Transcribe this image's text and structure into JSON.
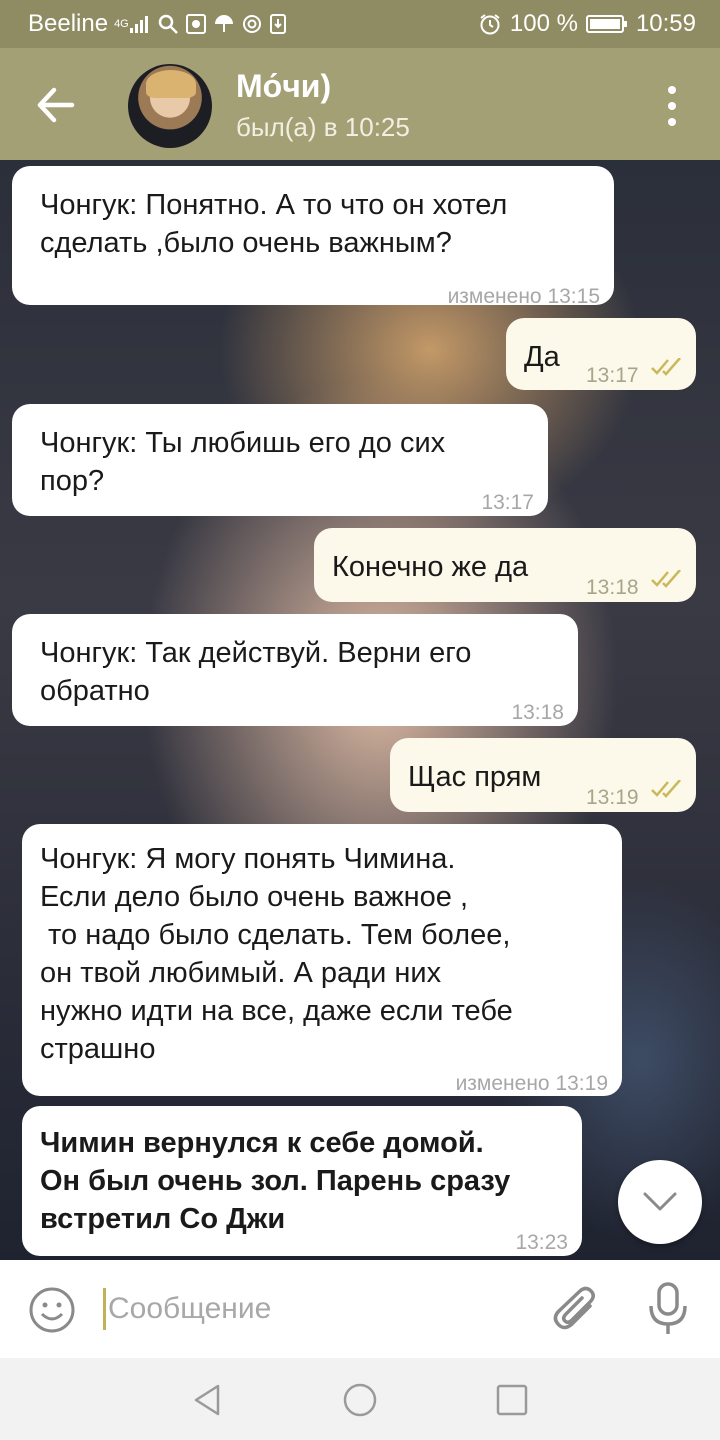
{
  "status_bar": {
    "carrier": "Beeline",
    "network": "4G",
    "battery": "100 %",
    "time": "10:59"
  },
  "header": {
    "title": "Мо́чи)",
    "subtitle": "был(а) в 10:25"
  },
  "messages": [
    {
      "direction": "in",
      "lines": [
        "Чонгук: Понятно. А то что он хотел",
        "сделать ,было очень важным?"
      ],
      "time": "изменено 13:15"
    },
    {
      "direction": "out",
      "text": "Да",
      "time": "13:17"
    },
    {
      "direction": "in",
      "lines": [
        "Чонгук: Ты любишь его до сих",
        "пор?"
      ],
      "time": "13:17"
    },
    {
      "direction": "out",
      "text": "Конечно же да",
      "time": "13:18"
    },
    {
      "direction": "in",
      "lines": [
        "Чонгук: Так действуй. Верни его",
        "обратно"
      ],
      "time": "13:18"
    },
    {
      "direction": "out",
      "text": "Щас прям",
      "time": "13:19"
    },
    {
      "direction": "in",
      "lines": [
        "Чонгук: Я могу понять Чимина.",
        "Если дело было очень важное ,",
        " то надо было сделать. Тем более,",
        "он твой любимый. А ради них",
        "нужно идти на все, даже если тебе",
        "страшно"
      ],
      "time": "изменено 13:19"
    },
    {
      "direction": "in",
      "bold": true,
      "lines": [
        "Чимин вернулся к себе домой.",
        "Он был очень зол. Парень сразу",
        "встретил Со Джи"
      ],
      "time": "13:23"
    }
  ],
  "composer": {
    "placeholder": "Сообщение"
  },
  "colors": {
    "header": "#a4a075",
    "status_bar": "#8f8c63",
    "outgoing_bubble": "#fcf8ea",
    "incoming_bubble": "#ffffff",
    "read_ticks": "#c9b95a"
  },
  "icons": [
    "back-arrow-icon",
    "more-vert-icon",
    "emoji-icon",
    "attach-icon",
    "mic-icon",
    "chevron-down-icon",
    "nav-back-icon",
    "nav-home-icon",
    "nav-recents-icon",
    "double-check-icon"
  ]
}
